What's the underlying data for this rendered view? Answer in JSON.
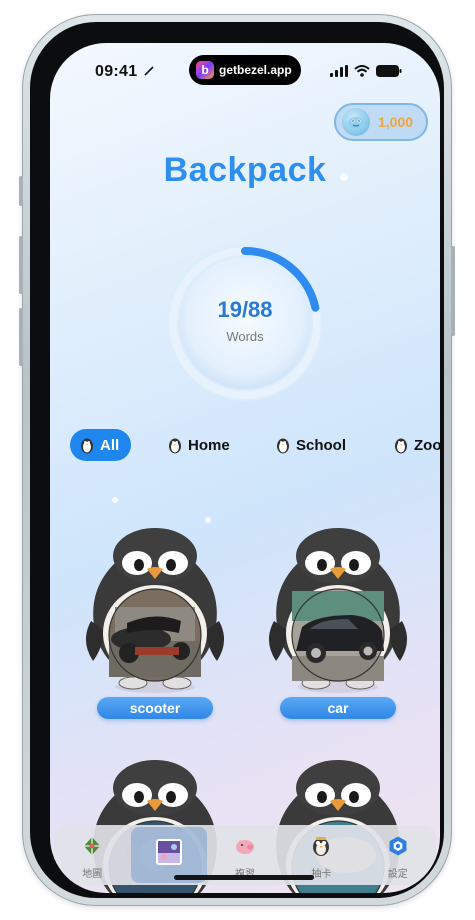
{
  "status_bar": {
    "time": "09:41",
    "island_text": "getbezel.app",
    "island_logo": "b"
  },
  "coins": {
    "value": "1,000",
    "icon": "dolphin-avatar-icon"
  },
  "header": {
    "title": "Backpack"
  },
  "progress": {
    "value_text": "19/88",
    "label": "Words",
    "fraction": 0.216
  },
  "categories": [
    {
      "label": "All",
      "active": true,
      "icon": "penguin-icon"
    },
    {
      "label": "Home",
      "active": false,
      "icon": "penguin-icon"
    },
    {
      "label": "School",
      "active": false,
      "icon": "penguin-icon"
    },
    {
      "label": "Zoo",
      "active": false,
      "icon": "penguin-icon"
    }
  ],
  "cards": [
    {
      "label": "scooter",
      "photo": "scooter-photo"
    },
    {
      "label": "car",
      "photo": "car-photo"
    },
    {
      "label": "",
      "photo": "tire-photo"
    },
    {
      "label": "",
      "photo": "ball-photo"
    }
  ],
  "nav": [
    {
      "label": "地圖",
      "icon": "map-icon",
      "active": false
    },
    {
      "label": "",
      "icon": "backpack-thumbnail-icon",
      "active": true
    },
    {
      "label": "複習",
      "icon": "piggy-icon",
      "active": false
    },
    {
      "label": "抽卡",
      "icon": "penguin-gacha-icon",
      "active": false
    },
    {
      "label": "設定",
      "icon": "settings-hexagon-icon",
      "active": false
    }
  ],
  "colors": {
    "accent": "#2e8ff0",
    "coin": "#f2a33a",
    "label_bg": "#3a8fe8"
  }
}
